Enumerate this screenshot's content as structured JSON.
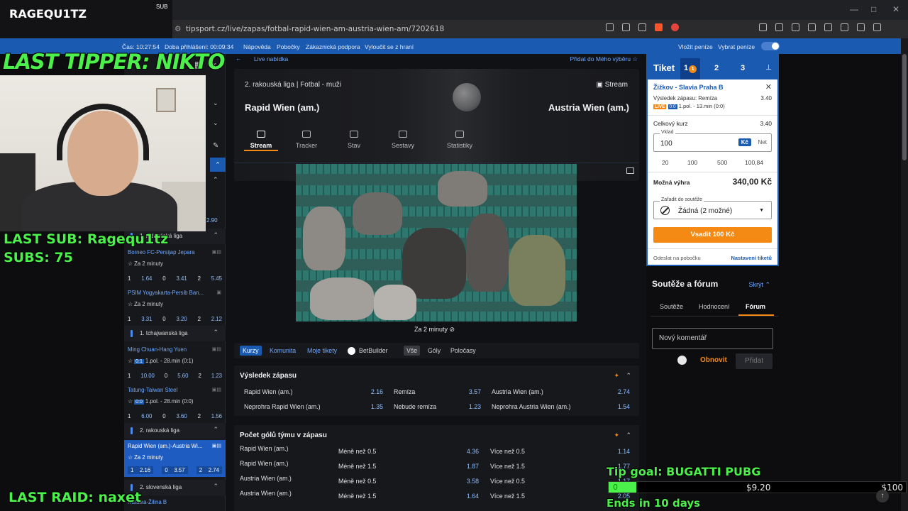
{
  "stream": {
    "channel": "RAGEQU1TZ",
    "sub_label": "SUB",
    "last_tipper": "LAST TIPPER: NIKTO",
    "last_sub": "LAST SUB: Ragequ1tz",
    "subs": "SUBS: 75",
    "last_raid": "LAST RAID: naxet",
    "tip_goal": "Tip goal: BUGATTI PUBG",
    "goal_start": "0",
    "goal_current": "$9.20",
    "goal_max": "$100",
    "goal_progress": 0.092,
    "goal_ends": "Ends in 10 days"
  },
  "browser": {
    "url": "tipsport.cz/live/zapas/fotbal-rapid-wien-am-austria-wien-am/7202618"
  },
  "site_nav": {
    "time": "Čas: 10:27:54",
    "login_duration": "Doba přihlášení: 00:09:34",
    "items": [
      "Nápověda",
      "Pobočky",
      "Zákaznická podpora",
      "Vyloučit se z hraní"
    ],
    "deposit": "Vložit peníze",
    "withdraw": "Vybrat peníze"
  },
  "sidebar": {
    "odds_top": "2.90",
    "groups": [
      {
        "league": "1. indonéská liga",
        "matches": [
          {
            "name": "Borneo FC-Persijap Jepara",
            "status": "Za 2 minuty",
            "o1": "1.64",
            "o0": "3.41",
            "o2": "5.45"
          },
          {
            "name": "PSIM Yogyakarta-Persib Ban...",
            "status": "Za 2 minuty",
            "o1": "3.31",
            "o0": "3.20",
            "o2": "2.12"
          }
        ]
      },
      {
        "league": "1. tchajwanská liga",
        "matches": [
          {
            "name": "Ming Chuan-Hang Yuen",
            "score": "0:1",
            "status": "1.pol. - 28.min (0:1)",
            "o1": "10.00",
            "o0": "5.60",
            "o2": "1.23"
          },
          {
            "name": "Tatung-Taiwan Steel",
            "score": "0:0",
            "status": "1.pol. - 28.min (0:0)",
            "o1": "6.00",
            "o0": "3.60",
            "o2": "1.56"
          }
        ]
      },
      {
        "league": "2. rakouská liga",
        "matches": [
          {
            "name": "Rapid Wien (am.)-Austria Wi...",
            "status": "Za 2 minuty",
            "o1": "2.16",
            "o0": "3.57",
            "o2": "2.74"
          }
        ]
      },
      {
        "league": "2. slovenská liga",
        "matches": [
          {
            "name": "Ratalka-Žilina B"
          }
        ]
      }
    ],
    "outcome_labels": [
      "1",
      "0",
      "2"
    ]
  },
  "match": {
    "back_label": "←",
    "breadcrumb": "Live nabídka",
    "favorite": "Přidat do Mého výběru",
    "league": "2. rakouská liga | Fotbal - muži",
    "home": "Rapid Wien (am.)",
    "away": "Austria Wien (am.)",
    "stream_label": "Stream",
    "tabs": [
      "Stream",
      "Tracker",
      "Stav",
      "Sestavy",
      "Statistiky"
    ],
    "video_caption": "Za 2 minuty"
  },
  "filters": {
    "primary": [
      "Kurzy",
      "Komunita",
      "Moje tikety"
    ],
    "betbuilder": "BetBuilder",
    "groups": [
      "Vše",
      "Góly",
      "Poločasy"
    ]
  },
  "markets": {
    "result": {
      "title": "Výsledek zápasu",
      "rows": [
        [
          {
            "label": "Rapid Wien (am.)",
            "odd": "2.16"
          },
          {
            "label": "Remíza",
            "odd": "3.57"
          },
          {
            "label": "Austria Wien (am.)",
            "odd": "2.74"
          }
        ],
        [
          {
            "label": "Neprohra Rapid Wien (am.)",
            "odd": "1.35"
          },
          {
            "label": "Nebude remíza",
            "odd": "1.23"
          },
          {
            "label": "Neprohra Austria Wien (am.)",
            "odd": "1.54"
          }
        ]
      ]
    },
    "goals": {
      "title": "Počet gólů týmu v zápasu",
      "rows": [
        {
          "team": "Rapid Wien (am.)",
          "under": "Méně než 0.5",
          "under_odd": "4.36",
          "over": "Více než 0.5",
          "over_odd": "1.14"
        },
        {
          "team": "Rapid Wien (am.)",
          "under": "Méně než 1.5",
          "under_odd": "1.87",
          "over": "Více než 1.5",
          "over_odd": "1.77"
        },
        {
          "team": "Austria Wien (am.)",
          "under": "Méně než 0.5",
          "under_odd": "3.58",
          "over": "Více než 0.5",
          "over_odd": "1.17"
        },
        {
          "team": "Austria Wien (am.)",
          "under": "Méně než 1.5",
          "under_odd": "1.64",
          "over": "Více než 1.5",
          "over_odd": "2.05"
        }
      ]
    }
  },
  "ticket": {
    "title": "Tiket",
    "tabs": [
      "1",
      "2",
      "3"
    ],
    "badge": "1",
    "match": "Žižkov - Slavia Praha B",
    "selection": "Výsledek zápasu: Remíza",
    "selection_odd": "3.40",
    "live": "LIVE",
    "score": "0:0",
    "period": "1.pol. - 13.min (0:0)",
    "total_label": "Celkový kurz",
    "total_odd": "3.40",
    "stake_label": "Vklad",
    "stake_value": "100",
    "currency": "Kč",
    "net": "Net",
    "quick": [
      "20",
      "100",
      "500",
      "100,84"
    ],
    "win_label": "Možná výhra",
    "win_value": "340,00 Kč",
    "contest_label": "Zařadit do soutěže",
    "contest_value": "Žádná (2 možné)",
    "place": "Vsadit 100 Kč",
    "send": "Odeslat na pobočku",
    "settings": "Nastavení tiketů"
  },
  "forum": {
    "title": "Soutěže a fórum",
    "hide": "Skrýt",
    "tabs": [
      "Soutěže",
      "Hodnocení",
      "Fórum"
    ],
    "placeholder": "Nový komentář",
    "refresh": "Obnovit",
    "add": "Přidat"
  },
  "colors": {
    "brand_blue": "#1b5ab1",
    "accent_orange": "#f48a14",
    "overlay_green": "#4bf04b"
  }
}
